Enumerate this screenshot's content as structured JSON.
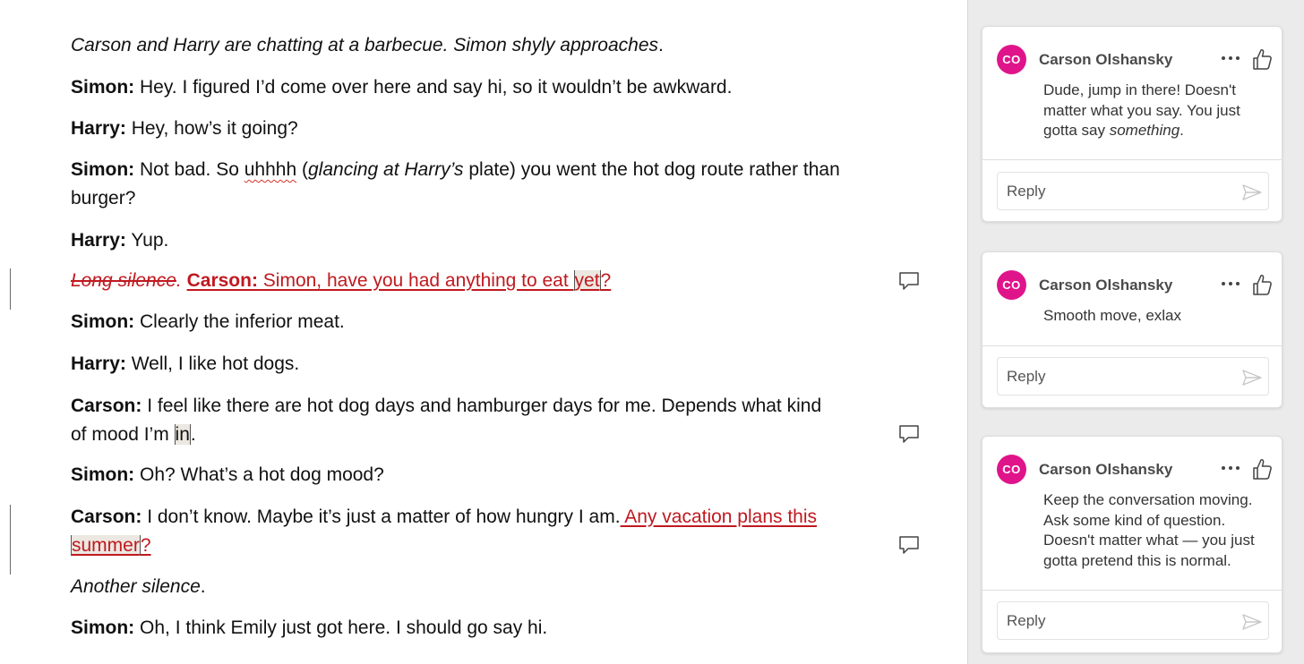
{
  "document": {
    "p1": {
      "text": "Carson and Harry are chatting at a barbecue. Simon shyly approaches",
      "tail": "."
    },
    "p2": {
      "speaker": "Simon:",
      "text": " Hey. I figured I’d come over here and say hi, so it wouldn’t be awkward."
    },
    "p3": {
      "speaker": "Harry:",
      "text": " Hey, how’s it going?"
    },
    "p4": {
      "speaker": "Simon:",
      "a": " Not bad. So ",
      "squiggle": "uhhhh",
      "b": " (",
      "italic": "glancing at Harry’s",
      "c": " plate) you went the hot dog route rather than burger?"
    },
    "p5": {
      "speaker": "Harry:",
      "text": " Yup."
    },
    "p6": {
      "deleted": "Long silence",
      "deleted_tail": ". ",
      "ins_speaker": "Carson:",
      "ins_a": " Simon, have you had anything to eat ",
      "ins_hl": "yet",
      "ins_b": "?"
    },
    "p7": {
      "speaker": "Simon:",
      "text": " Clearly the inferior meat."
    },
    "p8": {
      "speaker": "Harry:",
      "text": " Well, I like hot dogs."
    },
    "p9": {
      "speaker": "Carson:",
      "a": "  I feel like there are hot dog days and hamburger days for me. Depends what kind of mood I’m ",
      "hl": "in",
      "b": "."
    },
    "p10": {
      "speaker": "Simon:",
      "text": " Oh? What’s a hot dog mood?"
    },
    "p11": {
      "speaker": "Carson:",
      "a": " I don’t know. Maybe it’s just a matter of how hungry I am.",
      "ins_a": " Any vacation plans this ",
      "ins_hl": "summer",
      "ins_b": "?"
    },
    "p12": {
      "text": "Another silence",
      "tail": "."
    },
    "p13": {
      "speaker": "Simon:",
      "text": " Oh, I think Emily just got here. I should go say hi."
    }
  },
  "comments": [
    {
      "initials": "CO",
      "author": "Carson Olshansky",
      "text_a": "Dude, jump in there! Doesn't matter what you say. You just gotta say ",
      "text_em": "something",
      "text_b": ".",
      "reply_placeholder": "Reply"
    },
    {
      "initials": "CO",
      "author": "Carson Olshansky",
      "text_a": "Smooth move, exlax",
      "reply_placeholder": "Reply"
    },
    {
      "initials": "CO",
      "author": "Carson Olshansky",
      "text_a": "Keep the conversation moving. Ask some kind of question. Doesn't matter what — you just gotta pretend this is normal.",
      "reply_placeholder": "Reply"
    }
  ],
  "colors": {
    "accent_avatar": "#e0148a",
    "tracked_change": "#c0191f",
    "pane_background": "#ebebeb"
  },
  "icons": [
    "comment-icon",
    "more-options-icon",
    "thumbs-up-icon",
    "send-icon"
  ]
}
